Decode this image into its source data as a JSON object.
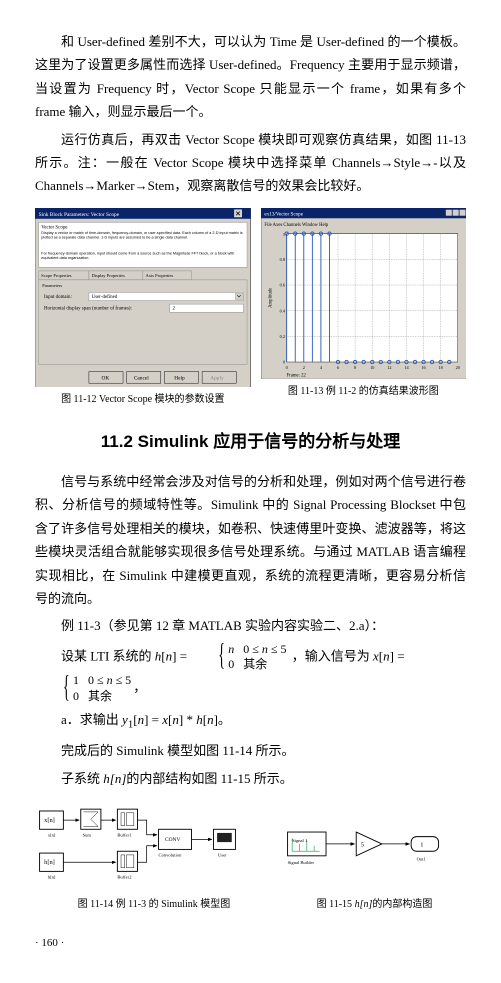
{
  "p1": "和 User-defined 差别不大，可以认为 Time 是 User-defined 的一个模板。这里为了设置更多属性而选择 User-defined。Frequency 主要用于显示频谱，当设置为 Frequency 时，Vector Scope 只能显示一个 frame，如果有多个 frame 输入，则显示最后一个。",
  "p2": "运行仿真后，再双击 Vector Scope 模块即可观察仿真结果，如图 11-13 所示。注：一般在 Vector Scope 模块中选择菜单 Channels→Style→-以及 Channels→Marker→Stem，观察离散信号的效果会比较好。",
  "dlg": {
    "title": "Sink Block Parameters: Vector Scope",
    "heading": "Vector Scope",
    "desc1": "Display a vector or matrix of time-domain, frequency-domain, or user-specified data. Each column of a 2-D input matrix is plotted as a separate data channel. 1-D inputs are assumed to be a single data channel.",
    "desc2": "For frequency-domain operation, input should come from a source such as the Magnitude FFT block, or a block with equivalent data organization.",
    "tab1": "Scope Properties",
    "tab2": "Display Properties",
    "tab3": "Axis Properties",
    "params": "Parameters",
    "l1": "Input domain:",
    "v1": "User-defined",
    "l2": "Horizontal display span (number of frames):",
    "v2": "2",
    "ok": "OK",
    "cancel": "Cancel",
    "help": "Help",
    "apply": "Apply"
  },
  "plot": {
    "title": "ex13/Vector Scope",
    "menu": "File  Axes  Channels  Window  Help",
    "ylabel": "Amplitude",
    "xlabel": "Frame: 22"
  },
  "chart_data": {
    "type": "bar",
    "title": "例 11-2 的仿真结果波形图",
    "xlabel": "Frame: 22",
    "ylabel": "Amplitude",
    "xlim": [
      0,
      20
    ],
    "ylim": [
      0,
      1
    ],
    "xticks": [
      0,
      2,
      4,
      6,
      8,
      10,
      12,
      14,
      16,
      18,
      20
    ],
    "yticks": [
      0,
      0.2,
      0.4,
      0.6,
      0.8,
      1
    ],
    "stem_x": [
      0,
      1,
      2,
      3,
      4,
      5,
      6,
      7,
      8,
      9,
      10,
      11,
      12,
      13,
      14,
      15,
      16,
      17,
      18,
      19
    ],
    "stem_y": [
      1,
      1,
      1,
      1,
      1,
      1,
      0,
      0,
      0,
      0,
      0,
      0,
      0,
      0,
      0,
      0,
      0,
      0,
      0,
      0
    ]
  },
  "cap1": "图 11-12   Vector Scope 模块的参数设置",
  "cap2": "图 11-13   例 11-2 的仿真结果波形图",
  "section": "11.2   Simulink 应用于信号的分析与处理",
  "p3": "信号与系统中经常会涉及对信号的分析和处理，例如对两个信号进行卷积、分析信号的频域特性等。Simulink 中的 Signal Processing Blockset 中包含了许多信号处理相关的模块，如卷积、快速傅里叶变换、滤波器等，将这些模块灵活组合就能够实现很多信号处理系统。与通过 MATLAB 语言编程实现相比，在 Simulink 中建模更直观，系统的流程更清晰，更容易分析信号的流向。",
  "p4": "例 11-3（参见第 12 章 MATLAB 实验内容实验二、2.a）：",
  "f1a": "设某 LTI 系统的 ",
  "f1b": "，输入信号为 ",
  "f2": "a．求输出 ",
  "f2y": "y₁[n] = x[n] * h[n]",
  "f2end": "。",
  "p5": "完成后的 Simulink 模型如图 11-14 所示。",
  "p6": "子系统 ",
  "p6h": "h[n]",
  "p6b": "的内部结构如图 11-15 所示。",
  "cap3": "图 11-14   例 11-3 的 Simulink 模型图",
  "cap4": "图 11-15   ",
  "cap4i": "h[n]",
  "cap4b": "的内部构造图",
  "sim14": {
    "sum": "Sum",
    "b1": "Buffer1",
    "b2": "Buffer2",
    "conv": "CONV",
    "cv": "Convolution",
    "us": "User",
    "sb": "Signal Builder",
    "sig": "Signal 1",
    "out": "Out1"
  },
  "pagenum": "· 160 ·"
}
